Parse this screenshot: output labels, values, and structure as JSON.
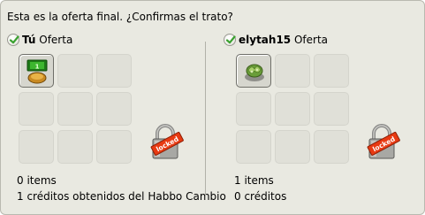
{
  "prompt": "Esta es la oferta final. ¿Confirmas el trato?",
  "left": {
    "user": "Tú",
    "offer_label": "Oferta",
    "items_count": "0 items",
    "credits_text": "1 créditos obtenidos del Habbo Cambio",
    "slots": [
      "credit-furni-icon",
      "",
      "",
      "",
      "",
      "",
      "",
      "",
      ""
    ]
  },
  "right": {
    "user": "elytah15",
    "offer_label": "Oferta",
    "items_count": "1 items",
    "credits_text": "0 créditos",
    "slots": [
      "cabbage-furni-icon",
      "",
      "",
      "",
      "",
      "",
      "",
      "",
      ""
    ]
  },
  "lock_label": "locked",
  "colors": {
    "panel": "#e9e9e1",
    "check": "#3aa12f",
    "lock_tag": "#e83a12"
  }
}
